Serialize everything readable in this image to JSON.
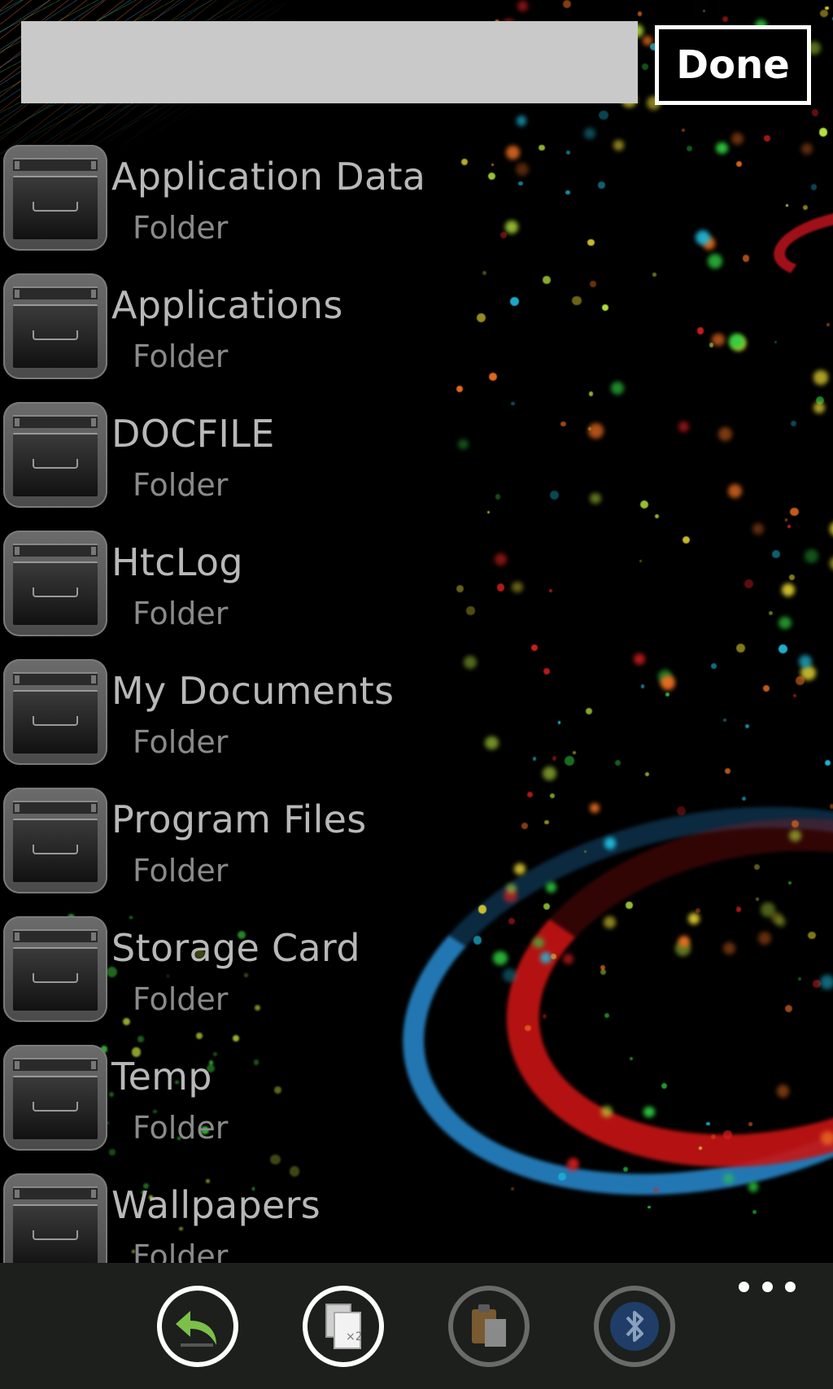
{
  "search": {
    "value": "",
    "placeholder": ""
  },
  "header": {
    "done_label": "Done"
  },
  "folders": [
    {
      "name": "Application Data",
      "type": "Folder"
    },
    {
      "name": "Applications",
      "type": "Folder"
    },
    {
      "name": "DOCFILE",
      "type": "Folder"
    },
    {
      "name": "HtcLog",
      "type": "Folder"
    },
    {
      "name": "My Documents",
      "type": "Folder"
    },
    {
      "name": "Program Files",
      "type": "Folder"
    },
    {
      "name": "Storage Card",
      "type": "Folder"
    },
    {
      "name": "Temp",
      "type": "Folder"
    },
    {
      "name": "Wallpapers",
      "type": "Folder"
    }
  ],
  "app_bar": {
    "buttons": [
      {
        "icon": "undo-arrow-icon",
        "state": "enabled"
      },
      {
        "icon": "copy-x2-icon",
        "state": "enabled"
      },
      {
        "icon": "paste-clipboard-icon",
        "state": "disabled"
      },
      {
        "icon": "bluetooth-icon",
        "state": "disabled"
      }
    ],
    "copy_badge": "×2",
    "bluetooth_glyph": "ᛒ",
    "more_icon": "ellipsis-icon"
  },
  "colors": {
    "background": "#000000",
    "search_box": "#c9c9c9",
    "app_bar": "#1c1f1c",
    "item_name": "#b8b8b8",
    "item_type": "#8a8a8a",
    "accent_green": "#7cc04a"
  }
}
